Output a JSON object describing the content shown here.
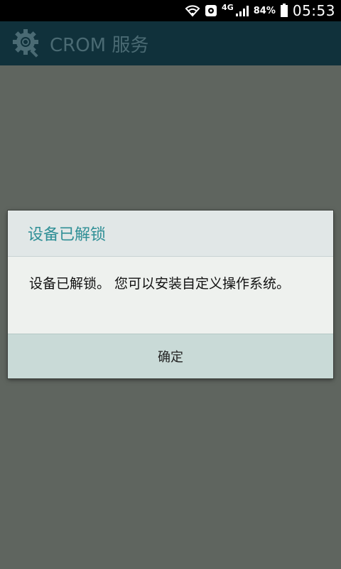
{
  "status_bar": {
    "network_type": "4G",
    "battery_percent": "84%",
    "time": "05:53",
    "icons": [
      "wifi-icon",
      "location-icon",
      "signal-icon",
      "battery-icon"
    ]
  },
  "action_bar": {
    "title": "CROM 服务",
    "icon": "gear-magnifier-icon"
  },
  "dialog": {
    "title": "设备已解锁",
    "message": "设备已解锁。 您可以安装自定义操作系统。",
    "ok_label": "确定"
  },
  "colors": {
    "action_bar_bg": "#10313b",
    "dialog_title": "#2f8f96",
    "dim_bg": "#5f655f",
    "footer_bg": "#c9dad7"
  }
}
